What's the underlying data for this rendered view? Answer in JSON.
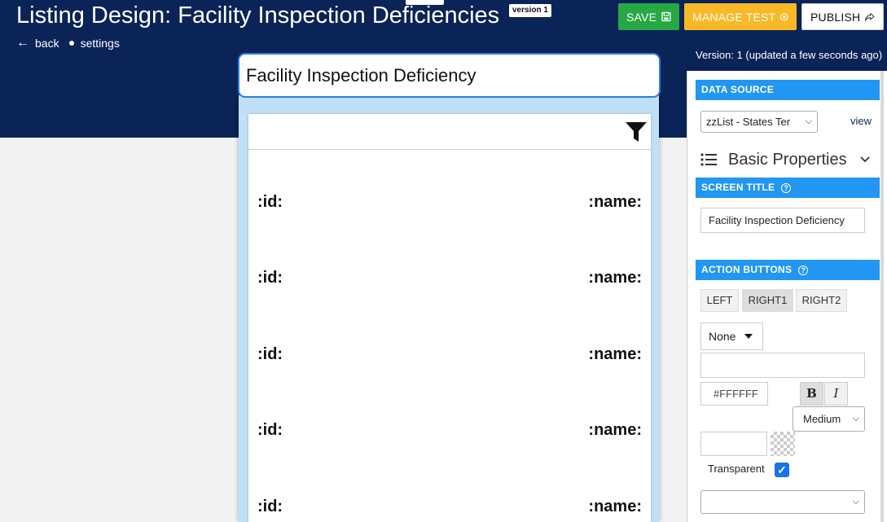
{
  "header": {
    "title": "Listing Design: Facility Inspection Deficiencies",
    "version_badge": "version 1",
    "nav_back": "back",
    "nav_settings": "settings",
    "save_label": "SAVE",
    "manage_test_label": "MANAGE TEST",
    "publish_label": "PUBLISH",
    "version_status": "Version: 1 (updated a few seconds ago)"
  },
  "preview": {
    "screen_title": "Facility Inspection Deficiency",
    "rows": [
      {
        "id": ":id:",
        "name": ":name:"
      },
      {
        "id": ":id:",
        "name": ":name:"
      },
      {
        "id": ":id:",
        "name": ":name:"
      },
      {
        "id": ":id:",
        "name": ":name:"
      },
      {
        "id": ":id:",
        "name": ":name:"
      }
    ]
  },
  "panel": {
    "data_source_heading": "DATA SOURCE",
    "data_source_value": "zzList - States Ter",
    "view_link": "view",
    "basic_properties": "Basic Properties",
    "screen_title_heading": "SCREEN TITLE",
    "screen_title_value": "Facility Inspection Deficiency",
    "action_buttons_heading": "ACTION BUTTONS",
    "seg_left": "LEFT",
    "seg_right1": "RIGHT1",
    "seg_right2": "RIGHT2",
    "button_type": "None",
    "text_color": "#FFFFFF",
    "bold_label": "B",
    "italic_label": "I",
    "font_size": "Medium",
    "transparent_label": "Transparent",
    "transparent_checked": true
  },
  "colors": {
    "header_bg": "#0b2457",
    "save": "#28a745",
    "manage_test": "#f9b826",
    "section_heading": "#2196f3",
    "preview_frame": "#bfe0f7"
  }
}
